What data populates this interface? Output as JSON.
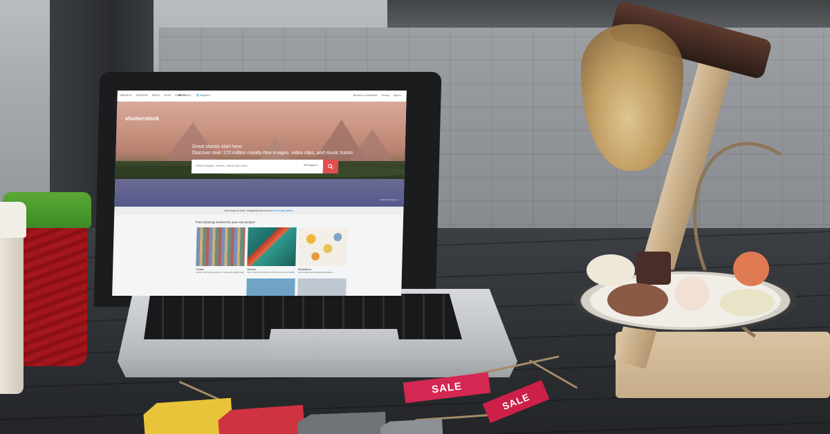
{
  "site": {
    "logo": "shutterstock",
    "nav": [
      "IMAGES ▾",
      "FOOTAGE",
      "MUSIC",
      "BLOG",
      "EDITOR"
    ],
    "lang": [
      "☎ 1-866-6..",
      "🌐 English ▾"
    ],
    "utils": [
      "Become a Contributor",
      "Pricing",
      "Sign in"
    ]
  },
  "hero": {
    "headline_line1": "Great stories start here.",
    "headline_line2": "Discover over 170 million royalty-free images, video clips, and music tracks.",
    "search_placeholder": "Search images, vectors, videos and music",
    "search_type": "All Images ▾",
    "credit": "landscape image by..."
  },
  "promo": {
    "text": "Stunning content, straightforward prices ",
    "link": "Find your plan ▸"
  },
  "content": {
    "title": "Find amazing content for your next project",
    "cards": [
      {
        "title": "Photos",
        "desc": "Explore professional photos. Thousands added daily"
      },
      {
        "title": "Vectors",
        "desc": "Take control with vectors. Edit with no loss of quality"
      },
      {
        "title": "Illustrations",
        "desc": "Get creative with beautiful illustrations"
      }
    ]
  },
  "tags": {
    "sale1": "SALE",
    "sale2": "SALE"
  },
  "icons": {
    "search": "search-icon"
  },
  "colors": {
    "accent": "#e14f4f",
    "link": "#1a7bd1",
    "sale": "#d42752"
  }
}
